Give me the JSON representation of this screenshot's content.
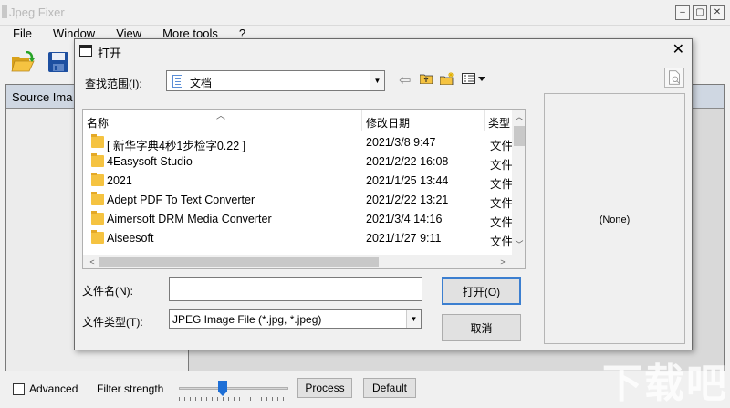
{
  "app": {
    "title": "Jpeg Fixer",
    "menu": [
      "File",
      "Window",
      "View",
      "More tools",
      "?"
    ],
    "window_controls": [
      "–",
      "▢",
      "✕"
    ],
    "source_panel_label": "Source Ima",
    "advanced_label": "Advanced",
    "filter_strength_label": "Filter strength",
    "filter_strength_value": 0.4,
    "process_label": "Process",
    "default_label": "Default",
    "watermark": "下载吧"
  },
  "dialog": {
    "title": "打开",
    "close_glyph": "✕",
    "look_in_label": "查找范围(I):",
    "look_in_value": "文档",
    "columns": {
      "name": "名称",
      "date": "修改日期",
      "type": "类型"
    },
    "files": [
      {
        "name": "[ 新华字典4秒1步检字0.22 ]",
        "date": "2021/3/8 9:47",
        "type": "文件"
      },
      {
        "name": "4Easysoft Studio",
        "date": "2021/2/22 16:08",
        "type": "文件"
      },
      {
        "name": "2021",
        "date": "2021/1/25 13:44",
        "type": "文件"
      },
      {
        "name": "Adept PDF To Text Converter",
        "date": "2021/2/22 13:21",
        "type": "文件"
      },
      {
        "name": "Aimersoft DRM Media Converter",
        "date": "2021/3/4 14:16",
        "type": "文件"
      },
      {
        "name": "Aiseesoft",
        "date": "2021/1/27 9:11",
        "type": "文件"
      }
    ],
    "preview_text": "(None)",
    "filename_label": "文件名(N):",
    "filename_value": "",
    "filetype_label": "文件类型(T):",
    "filetype_value": "JPEG Image File (*.jpg, *.jpeg)",
    "open_label": "打开(O)",
    "cancel_label": "取消"
  }
}
